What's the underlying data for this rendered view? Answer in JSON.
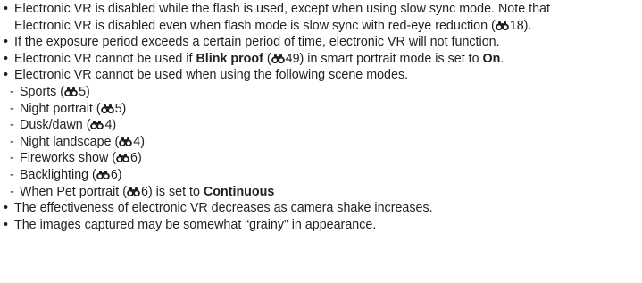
{
  "bullet_char": "•",
  "sub_char": "-",
  "ref_icon": "reference-binoculars-icon",
  "items": [
    {
      "line1": "Electronic VR is disabled while the flash is used, except when using slow sync mode. Note that",
      "line2_pre": "Electronic VR is disabled even when flash mode is slow sync with red-eye reduction (",
      "line2_ref": "18",
      "line2_post": ")."
    },
    {
      "text": "If the exposure period exceeds a certain period of time, electronic VR will not function."
    },
    {
      "pre": "Electronic VR cannot be used if ",
      "bold": "Blink proof",
      "mid1": " (",
      "ref": "49",
      "mid2": ") in smart portrait mode is set to ",
      "bold2": "On",
      "post": "."
    },
    {
      "text": "Electronic VR cannot be used when using the following scene modes.",
      "subs": [
        {
          "label": "Sports (",
          "ref": "5",
          "post": ")"
        },
        {
          "label": "Night portrait (",
          "ref": "5",
          "post": ")"
        },
        {
          "label": "Dusk/dawn (",
          "ref": "4",
          "post": ")"
        },
        {
          "label": "Night landscape (",
          "ref": "4",
          "post": ")"
        },
        {
          "label": "Fireworks show (",
          "ref": "6",
          "post": ")"
        },
        {
          "label": "Backlighting (",
          "ref": "6",
          "post": ")"
        },
        {
          "label": "When Pet portrait (",
          "ref": "6",
          "post": ") is set to ",
          "bold": "Continuous"
        }
      ]
    },
    {
      "text": "The effectiveness of electronic VR decreases as camera shake increases."
    },
    {
      "text": "The images captured may be somewhat “grainy” in appearance."
    }
  ]
}
